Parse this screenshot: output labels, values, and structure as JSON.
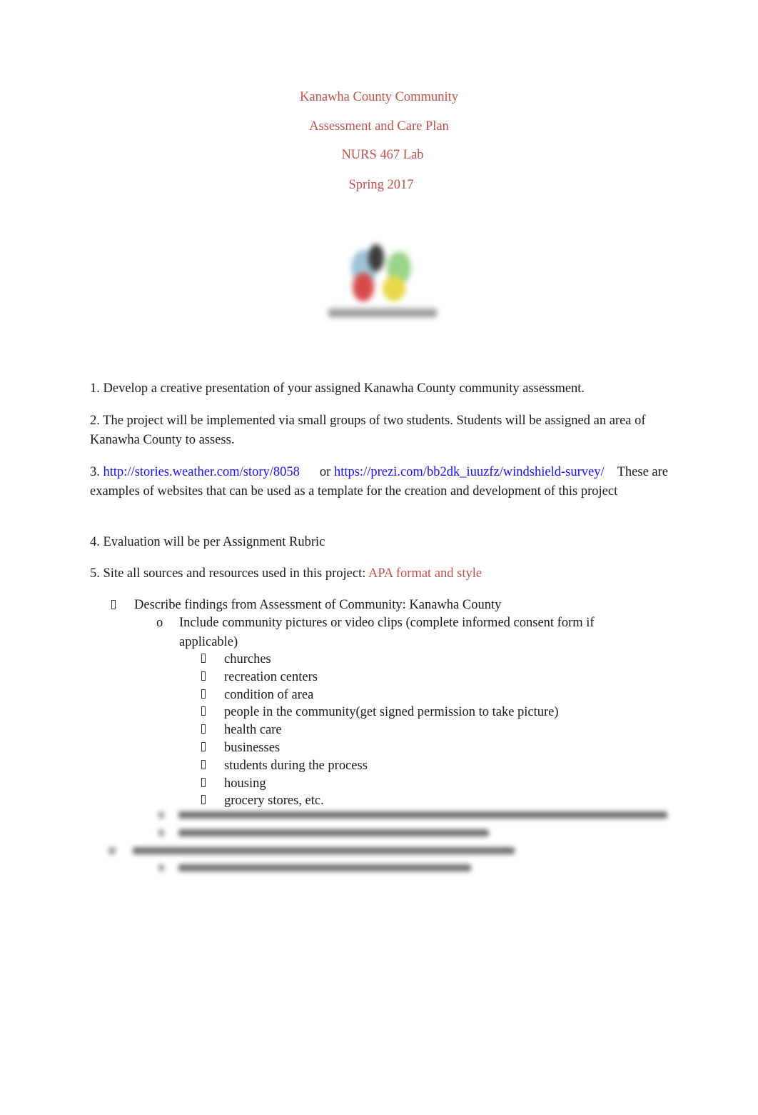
{
  "header": {
    "title_line1": "Kanawha County Community",
    "title_line2": "Assessment and Care Plan",
    "course": "NURS 467 Lab",
    "term": "Spring 2017",
    "title_color": "#c0504d"
  },
  "logo": {
    "icon": "colorful-circles-logo-icon",
    "blurred": true
  },
  "items": {
    "item1": "1. Develop a creative presentation of your assigned Kanawha County community assessment.",
    "item2": "2. The project will be implemented via small groups of two students.   Students will be assigned an area of Kanawha County to assess.",
    "item3_prefix": "3. ",
    "item3_link1": "http://stories.weather.com/story/8058",
    "item3_or": "or",
    "item3_link2": "https://prezi.com/bb2dk_iuuzfz/windshield-survey/",
    "item3_suffix": "These are examples of websites that can be used as a template for the creation and development of this project",
    "item4": "4. Evaluation will be per Assignment Rubric",
    "item5_prefix": "5. Site all sources and resources used in this project:",
    "item5_highlight": "APA format and style",
    "link_color": "#1a0dff"
  },
  "outline": {
    "level1_bullet": "",
    "level1_text": "Describe findings from Assessment of Community: Kanawha County",
    "level2_bullet": "o",
    "level2_text": "Include community pictures or video clips (complete informed consent form if applicable)",
    "level3_items": [
      "churches",
      "recreation centers",
      "condition of area",
      "people in the community(get signed permission to take picture)",
      "health care",
      "businesses",
      "students during the process",
      "housing",
      "grocery stores, etc."
    ]
  },
  "blurred_section": {
    "visible": true,
    "lines": 4
  }
}
